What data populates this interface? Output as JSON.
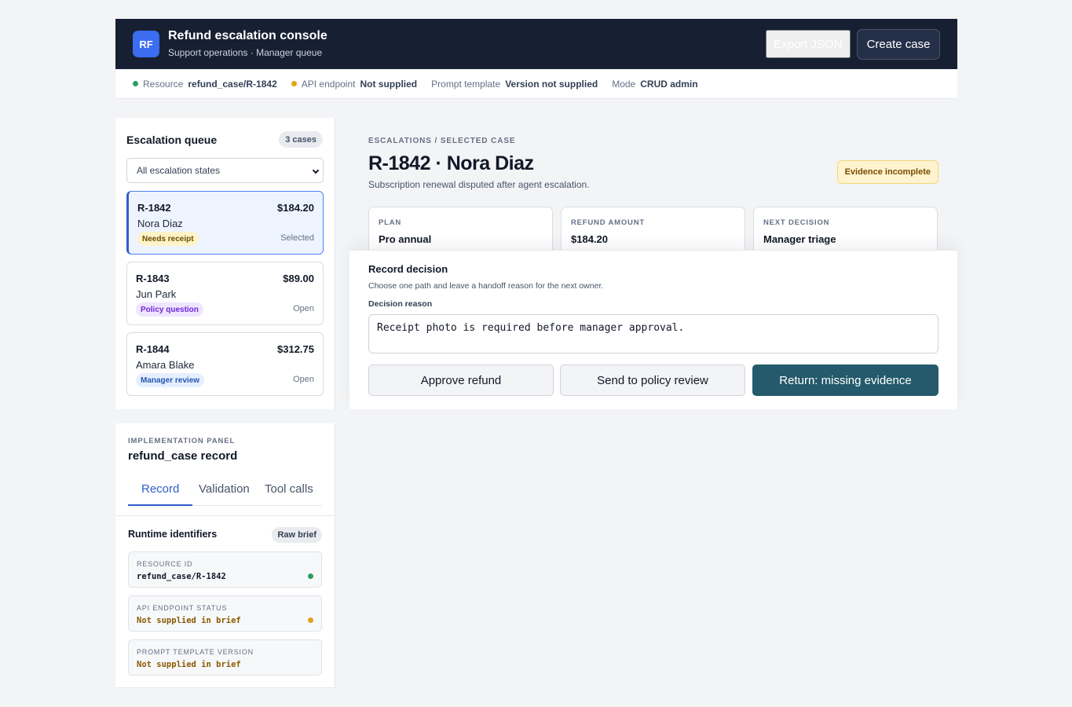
{
  "colors": {
    "success": "#2f9e61",
    "warning": "#e3a21a",
    "accent": "#315ec7",
    "primary_action": "#245a6b"
  },
  "app": {
    "logo": "RF",
    "title": "Refund escalation console",
    "subtitle": "Support operations · Manager queue",
    "export_label": "Export JSON",
    "create_label": "Create case"
  },
  "status": [
    {
      "label": "Resource",
      "value": "refund_case/R-1842",
      "dot": "#2f9e61"
    },
    {
      "label": "API endpoint",
      "value": "Not supplied",
      "dot": "#e3a21a"
    },
    {
      "label": "Prompt template",
      "value": "Version not supplied"
    },
    {
      "label": "Mode",
      "value": "CRUD admin"
    }
  ],
  "queue": {
    "title": "Escalation queue",
    "count": "3 cases",
    "filter": "All escalation states",
    "cases": [
      {
        "id": "R-1842",
        "amount": "$184.20",
        "name": "Nora Diaz",
        "tag": "Needs receipt",
        "state": "Selected"
      },
      {
        "id": "R-1843",
        "amount": "$89.00",
        "name": "Jun Park",
        "tag": "Policy question",
        "state": "Open"
      },
      {
        "id": "R-1844",
        "amount": "$312.75",
        "name": "Amara Blake",
        "tag": "Manager review",
        "state": "Open"
      }
    ]
  },
  "detail": {
    "breadcrumb": "Escalations / Selected case",
    "title": "R-1842 · Nora Diaz",
    "subtitle": "Subscription renewal disputed after agent escalation.",
    "badge": "Evidence incomplete",
    "metrics": [
      {
        "label": "Plan",
        "value": "Pro annual"
      },
      {
        "label": "Refund amount",
        "value": "$184.20"
      },
      {
        "label": "Next decision",
        "value": "Manager triage"
      }
    ],
    "decision": {
      "title": "Record decision",
      "help": "Choose one path and leave a handoff reason for the next owner.",
      "field_label": "Decision reason",
      "reason": "Receipt photo is required before manager approval.",
      "actions": [
        "Approve refund",
        "Send to policy review",
        "Return: missing evidence"
      ]
    }
  },
  "impl": {
    "kicker": "Implementation panel",
    "title": "refund_case record",
    "tabs": [
      "Record",
      "Validation",
      "Tool calls"
    ],
    "runtime_title": "Runtime identifiers",
    "raw_label": "Raw brief",
    "ids": [
      {
        "label": "Resource ID",
        "value": "refund_case/R-1842",
        "dot": "#2f9e61"
      },
      {
        "label": "API endpoint status",
        "value": "Not supplied in brief",
        "dot": "#e3a21a"
      },
      {
        "label": "Prompt template version",
        "value": "Not supplied in brief"
      }
    ]
  }
}
